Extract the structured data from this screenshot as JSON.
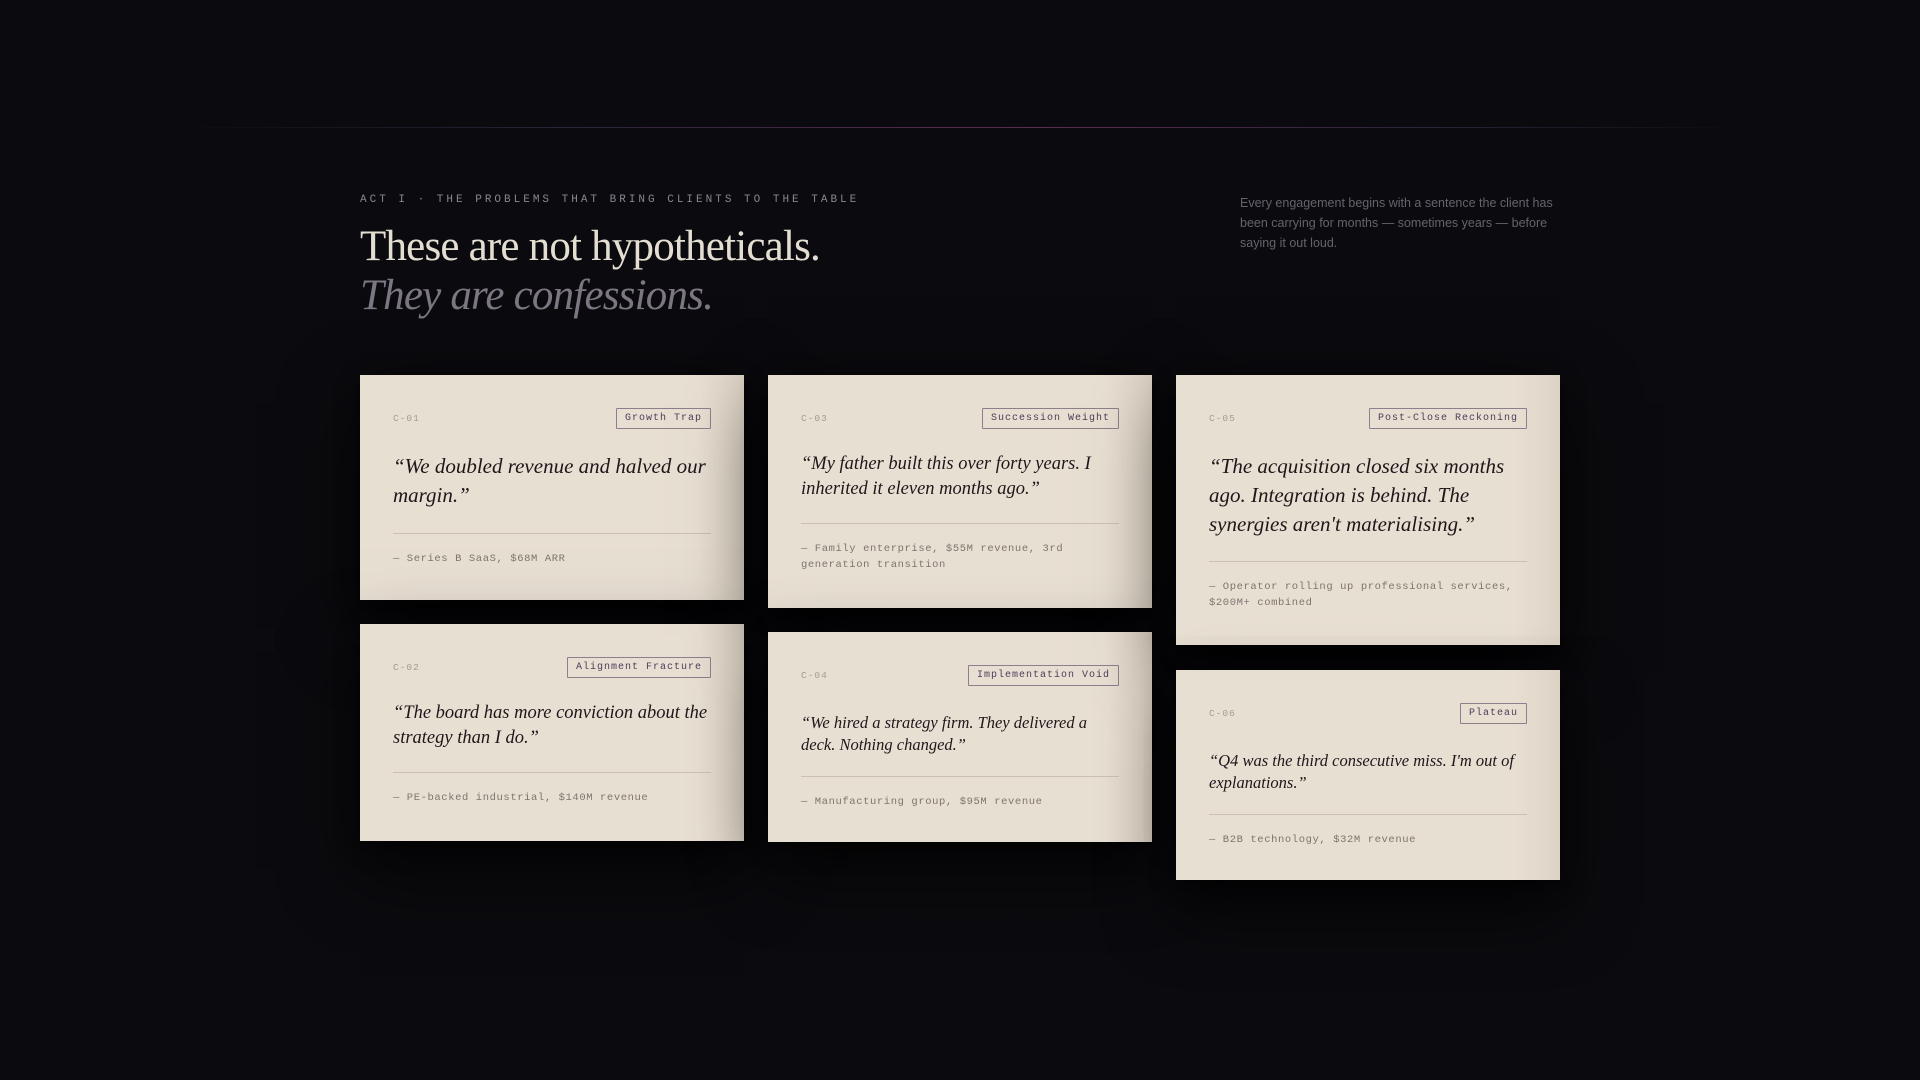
{
  "section": {
    "eyebrow": "ACT I · THE PROBLEMS THAT BRING CLIENTS TO THE TABLE",
    "headline": "These are not hypotheticals.",
    "headline_italic": "They are confessions.",
    "intro": "Every engagement begins with a sentence the client has been carrying for months — sometimes years — before saying it out loud."
  },
  "colors": {
    "background": "#0b0b0f",
    "card": "#e8dfd3",
    "tag_text": "#4e3d58",
    "accent_line": "#5b2c4e"
  },
  "cards": [
    {
      "id": "C-01",
      "tag": "Growth Trap",
      "quote": "“We doubled revenue and halved our margin.”",
      "attribution": "— Series B SaaS, $68M ARR"
    },
    {
      "id": "C-02",
      "tag": "Alignment Fracture",
      "quote": "“The board has more conviction about the strategy than I do.”",
      "attribution": "— PE-backed industrial, $140M revenue"
    },
    {
      "id": "C-03",
      "tag": "Succession Weight",
      "quote": "“My father built this over forty years. I inherited it eleven months ago.”",
      "attribution": "— Family enterprise, $55M revenue, 3rd generation transition"
    },
    {
      "id": "C-04",
      "tag": "Implementation Void",
      "quote": "“We hired a strategy firm. They delivered a deck. Nothing changed.”",
      "attribution": "— Manufacturing group, $95M revenue"
    },
    {
      "id": "C-05",
      "tag": "Post-Close Reckoning",
      "quote": "“The acquisition closed six months ago. Integration is behind. The synergies aren't materialising.”",
      "attribution": "— Operator rolling up professional services, $200M+ combined"
    },
    {
      "id": "C-06",
      "tag": "Plateau",
      "quote": "“Q4 was the third consecutive miss. I'm out of explanations.”",
      "attribution": "— B2B technology, $32M revenue"
    }
  ]
}
